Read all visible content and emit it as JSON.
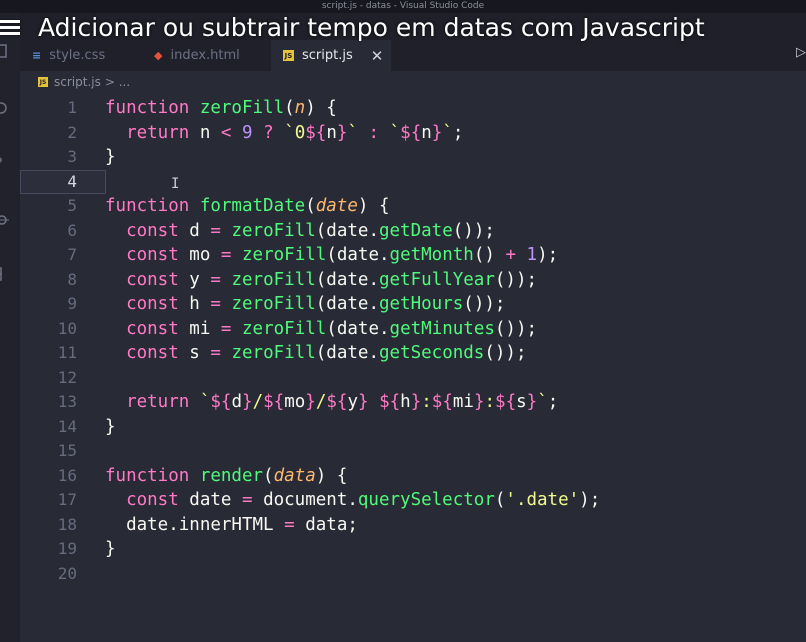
{
  "window": {
    "title": "script.js - datas - Visual Studio Code"
  },
  "video": {
    "title": "Adicionar ou subtrair tempo em datas com Javascript"
  },
  "tabs": [
    {
      "label": "style.css",
      "icon": "css-file-icon",
      "active": false
    },
    {
      "label": "index.html",
      "icon": "html-file-icon",
      "active": false
    },
    {
      "label": "script.js",
      "icon": "js-file-icon",
      "active": true
    }
  ],
  "breadcrumb": {
    "file": "script.js",
    "rest": "> ..."
  },
  "editor": {
    "current_line": 4,
    "lines": [
      {
        "n": "1",
        "tokens": [
          [
            "kw",
            "function "
          ],
          [
            "fn",
            "zeroFill"
          ],
          [
            "pl",
            "("
          ],
          [
            "param",
            "n"
          ],
          [
            "pl",
            ") {"
          ]
        ]
      },
      {
        "n": "2",
        "tokens": [
          [
            "pl",
            "  "
          ],
          [
            "ret",
            "return"
          ],
          [
            "pl",
            " n "
          ],
          [
            "op",
            "<"
          ],
          [
            "pl",
            " "
          ],
          [
            "num",
            "9"
          ],
          [
            "pl",
            " "
          ],
          [
            "op",
            "?"
          ],
          [
            "pl",
            " "
          ],
          [
            "str",
            "`0"
          ],
          [
            "interp",
            "${"
          ],
          [
            "pl",
            "n"
          ],
          [
            "interp",
            "}"
          ],
          [
            "str",
            "`"
          ],
          [
            "pl",
            " "
          ],
          [
            "op",
            ":"
          ],
          [
            "pl",
            " "
          ],
          [
            "str",
            "`"
          ],
          [
            "interp",
            "${"
          ],
          [
            "pl",
            "n"
          ],
          [
            "interp",
            "}"
          ],
          [
            "str",
            "`"
          ],
          [
            "pl",
            ";"
          ]
        ]
      },
      {
        "n": "3",
        "tokens": [
          [
            "pl",
            "}"
          ]
        ]
      },
      {
        "n": "4",
        "tokens": []
      },
      {
        "n": "5",
        "tokens": [
          [
            "kw",
            "function "
          ],
          [
            "fn",
            "formatDate"
          ],
          [
            "pl",
            "("
          ],
          [
            "param",
            "date"
          ],
          [
            "pl",
            ") {"
          ]
        ]
      },
      {
        "n": "6",
        "tokens": [
          [
            "pl",
            "  "
          ],
          [
            "kw",
            "const"
          ],
          [
            "pl",
            " d "
          ],
          [
            "op",
            "="
          ],
          [
            "pl",
            " "
          ],
          [
            "fn",
            "zeroFill"
          ],
          [
            "pl",
            "(date."
          ],
          [
            "fn",
            "getDate"
          ],
          [
            "pl",
            "());"
          ]
        ]
      },
      {
        "n": "7",
        "tokens": [
          [
            "pl",
            "  "
          ],
          [
            "kw",
            "const"
          ],
          [
            "pl",
            " mo "
          ],
          [
            "op",
            "="
          ],
          [
            "pl",
            " "
          ],
          [
            "fn",
            "zeroFill"
          ],
          [
            "pl",
            "(date."
          ],
          [
            "fn",
            "getMonth"
          ],
          [
            "pl",
            "() "
          ],
          [
            "op",
            "+"
          ],
          [
            "pl",
            " "
          ],
          [
            "num",
            "1"
          ],
          [
            "pl",
            ");"
          ]
        ]
      },
      {
        "n": "8",
        "tokens": [
          [
            "pl",
            "  "
          ],
          [
            "kw",
            "const"
          ],
          [
            "pl",
            " y "
          ],
          [
            "op",
            "="
          ],
          [
            "pl",
            " "
          ],
          [
            "fn",
            "zeroFill"
          ],
          [
            "pl",
            "(date."
          ],
          [
            "fn",
            "getFullYear"
          ],
          [
            "pl",
            "());"
          ]
        ]
      },
      {
        "n": "9",
        "tokens": [
          [
            "pl",
            "  "
          ],
          [
            "kw",
            "const"
          ],
          [
            "pl",
            " h "
          ],
          [
            "op",
            "="
          ],
          [
            "pl",
            " "
          ],
          [
            "fn",
            "zeroFill"
          ],
          [
            "pl",
            "(date."
          ],
          [
            "fn",
            "getHours"
          ],
          [
            "pl",
            "());"
          ]
        ]
      },
      {
        "n": "10",
        "tokens": [
          [
            "pl",
            "  "
          ],
          [
            "kw",
            "const"
          ],
          [
            "pl",
            " mi "
          ],
          [
            "op",
            "="
          ],
          [
            "pl",
            " "
          ],
          [
            "fn",
            "zeroFill"
          ],
          [
            "pl",
            "(date."
          ],
          [
            "fn",
            "getMinutes"
          ],
          [
            "pl",
            "());"
          ]
        ]
      },
      {
        "n": "11",
        "tokens": [
          [
            "pl",
            "  "
          ],
          [
            "kw",
            "const"
          ],
          [
            "pl",
            " s "
          ],
          [
            "op",
            "="
          ],
          [
            "pl",
            " "
          ],
          [
            "fn",
            "zeroFill"
          ],
          [
            "pl",
            "(date."
          ],
          [
            "fn",
            "getSeconds"
          ],
          [
            "pl",
            "());"
          ]
        ]
      },
      {
        "n": "12",
        "tokens": []
      },
      {
        "n": "13",
        "tokens": [
          [
            "pl",
            "  "
          ],
          [
            "ret",
            "return"
          ],
          [
            "pl",
            " "
          ],
          [
            "str",
            "`"
          ],
          [
            "interp",
            "${"
          ],
          [
            "pl",
            "d"
          ],
          [
            "interp",
            "}"
          ],
          [
            "str",
            "/"
          ],
          [
            "interp",
            "${"
          ],
          [
            "pl",
            "mo"
          ],
          [
            "interp",
            "}"
          ],
          [
            "str",
            "/"
          ],
          [
            "interp",
            "${"
          ],
          [
            "pl",
            "y"
          ],
          [
            "interp",
            "}"
          ],
          [
            "str",
            " "
          ],
          [
            "interp",
            "${"
          ],
          [
            "pl",
            "h"
          ],
          [
            "interp",
            "}"
          ],
          [
            "str",
            ":"
          ],
          [
            "interp",
            "${"
          ],
          [
            "pl",
            "mi"
          ],
          [
            "interp",
            "}"
          ],
          [
            "str",
            ":"
          ],
          [
            "interp",
            "${"
          ],
          [
            "pl",
            "s"
          ],
          [
            "interp",
            "}"
          ],
          [
            "str",
            "`"
          ],
          [
            "pl",
            ";"
          ]
        ]
      },
      {
        "n": "14",
        "tokens": [
          [
            "pl",
            "}"
          ]
        ]
      },
      {
        "n": "15",
        "tokens": []
      },
      {
        "n": "16",
        "tokens": [
          [
            "kw",
            "function "
          ],
          [
            "fn",
            "render"
          ],
          [
            "pl",
            "("
          ],
          [
            "param",
            "data"
          ],
          [
            "pl",
            ") {"
          ]
        ]
      },
      {
        "n": "17",
        "tokens": [
          [
            "pl",
            "  "
          ],
          [
            "kw",
            "const"
          ],
          [
            "pl",
            " date "
          ],
          [
            "op",
            "="
          ],
          [
            "pl",
            " document."
          ],
          [
            "fn",
            "querySelector"
          ],
          [
            "pl",
            "("
          ],
          [
            "str",
            "'.date'"
          ],
          [
            "pl",
            ");"
          ]
        ]
      },
      {
        "n": "18",
        "tokens": [
          [
            "pl",
            "  date.innerHTML "
          ],
          [
            "op",
            "="
          ],
          [
            "pl",
            " data;"
          ]
        ]
      },
      {
        "n": "19",
        "tokens": [
          [
            "pl",
            "}"
          ]
        ]
      },
      {
        "n": "20",
        "tokens": []
      }
    ]
  }
}
